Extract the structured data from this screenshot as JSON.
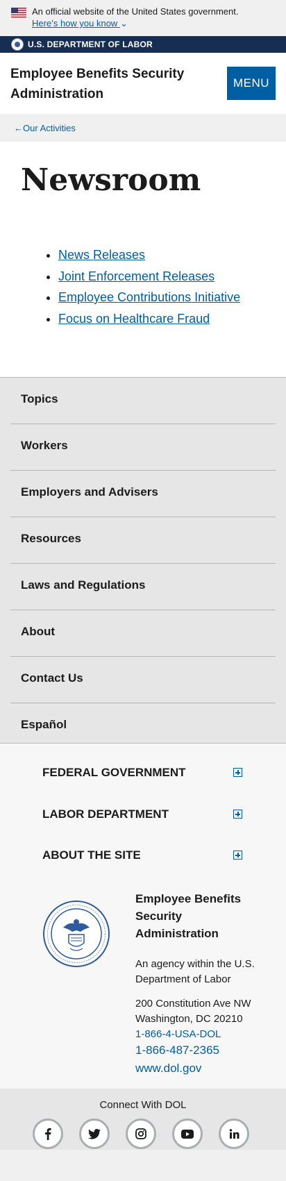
{
  "banner": {
    "official_text": "An official website of the United States government.",
    "how_link": "Here’s how you know"
  },
  "agency": {
    "name": "U.S. DEPARTMENT OF LABOR"
  },
  "header": {
    "site_title": "Employee Benefits Security Administration",
    "menu_label": "MENU"
  },
  "breadcrumb": {
    "back_label": "Our Activities",
    "icon": "arrow-left-icon"
  },
  "main": {
    "title": "Newsroom",
    "links": [
      "News Releases",
      "Joint Enforcement Releases",
      "Employee Contributions Initiative",
      "Focus on Healthcare Fraud"
    ]
  },
  "subnav": {
    "items": [
      "Topics",
      "Workers",
      "Employers and Advisers",
      "Resources",
      "Laws and Regulations",
      "About",
      "Contact Us",
      "Español"
    ]
  },
  "footer": {
    "accordions": [
      "FEDERAL GOVERNMENT",
      "LABOR DEPARTMENT",
      "ABOUT THE SITE"
    ],
    "org_name": "Employee Benefits Security Administration",
    "org_desc": "An agency within the U.S. Department of Labor",
    "address_line1": "200 Constitution Ave NW",
    "address_line2": "Washington, DC 20210",
    "phone_text": "1-866-4-USA-DOL",
    "phone_number": "1-866-487-2365",
    "website": "www.dol.gov"
  },
  "social": {
    "title": "Connect With DOL",
    "icons": [
      "facebook-icon",
      "twitter-icon",
      "instagram-icon",
      "youtube-icon",
      "linkedin-icon"
    ]
  },
  "colors": {
    "primary_link": "#005ea2",
    "agency_bar": "#162e51",
    "text": "#1b1b1b",
    "gray_bg": "#f0f0f0"
  }
}
